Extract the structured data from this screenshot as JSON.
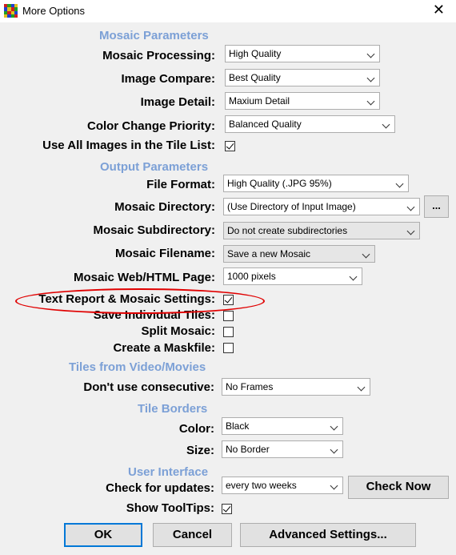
{
  "window": {
    "title": "More Options",
    "close_glyph": "✕"
  },
  "sections": {
    "mosaic_parameters": "Mosaic Parameters",
    "output_parameters": "Output Parameters",
    "tiles_from_video": "Tiles from Video/Movies",
    "tile_borders": "Tile Borders",
    "user_interface": "User Interface"
  },
  "labels": {
    "mosaic_processing": "Mosaic Processing:",
    "image_compare": "Image Compare:",
    "image_detail": "Image Detail:",
    "color_change_priority": "Color Change Priority:",
    "use_all_images": "Use All Images in the Tile List:",
    "file_format": "File Format:",
    "mosaic_directory": "Mosaic Directory:",
    "mosaic_subdirectory": "Mosaic Subdirectory:",
    "mosaic_filename": "Mosaic Filename:",
    "mosaic_web_page": "Mosaic Web/HTML Page:",
    "text_report": "Text Report & Mosaic Settings:",
    "save_individual_tiles": "Save Individual Tiles:",
    "split_mosaic": "Split Mosaic:",
    "create_maskfile": "Create a Maskfile:",
    "dont_use_consecutive": "Don't use consecutive:",
    "color": "Color:",
    "size": "Size:",
    "check_for_updates": "Check for updates:",
    "show_tooltips": "Show ToolTips:"
  },
  "values": {
    "mosaic_processing": "High Quality",
    "image_compare": "Best Quality",
    "image_detail": "Maxium Detail",
    "color_change_priority": "Balanced Quality",
    "file_format": "High Quality (.JPG  95%)",
    "mosaic_directory": "(Use Directory of Input Image)",
    "mosaic_subdirectory": "Do not create subdirectories",
    "mosaic_filename": "Save a new Mosaic",
    "mosaic_web_page": "1000 pixels",
    "dont_use_consecutive": "No Frames",
    "color": "Black",
    "size": "No Border",
    "check_for_updates": "every two weeks"
  },
  "checks": {
    "use_all_images": true,
    "text_report": true,
    "save_individual_tiles": false,
    "split_mosaic": false,
    "create_maskfile": false,
    "show_tooltips": true
  },
  "buttons": {
    "browse": "...",
    "check_now": "Check Now",
    "ok": "OK",
    "cancel": "Cancel",
    "advanced_settings": "Advanced Settings..."
  },
  "colors": {
    "section_heading": "#7ca0d6",
    "annotation_ellipse": "#e00000",
    "focus_border": "#0078d7"
  }
}
